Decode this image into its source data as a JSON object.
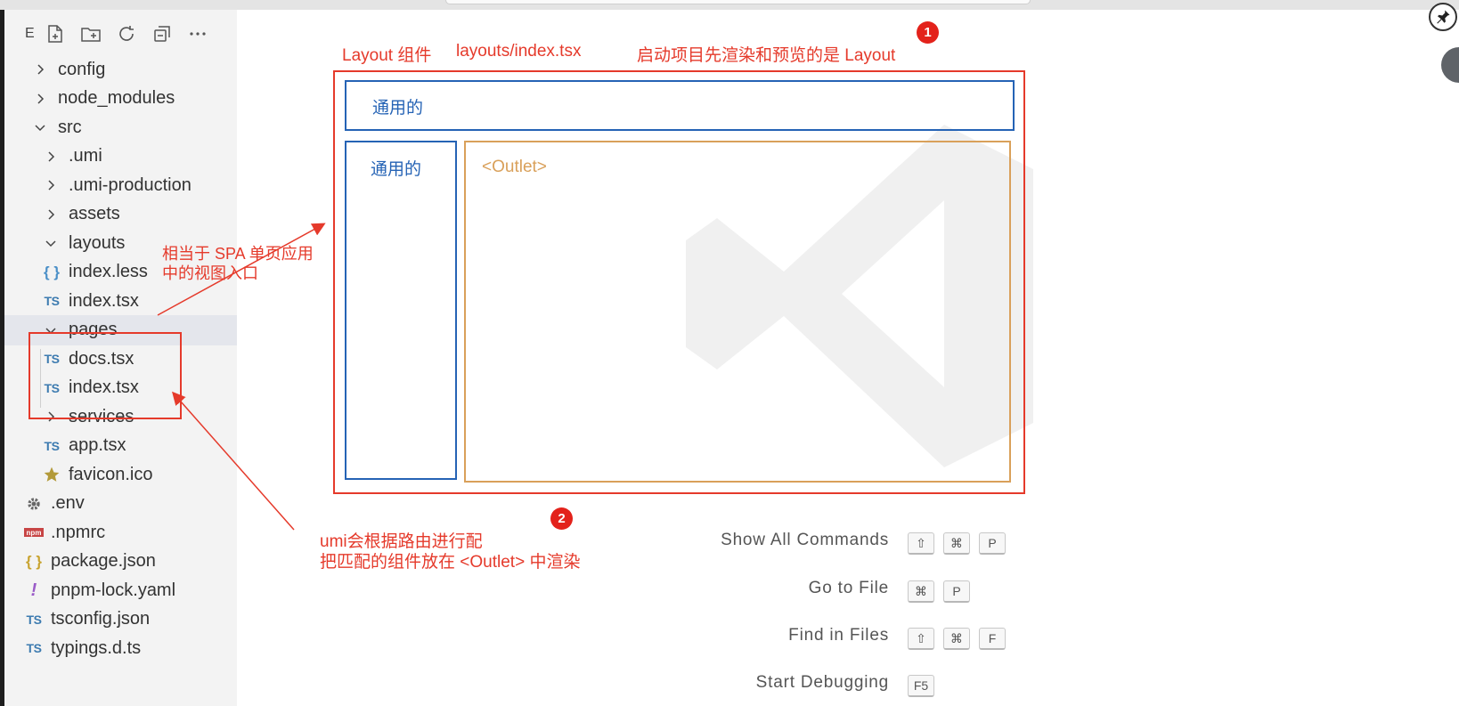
{
  "explorer": {
    "toolbar": {
      "label": "E",
      "icons": [
        "new-file-icon",
        "new-folder-icon",
        "refresh-icon",
        "collapse-all-icon",
        "more-icon"
      ]
    },
    "items": [
      {
        "label": "config",
        "type": "folder",
        "expanded": false
      },
      {
        "label": "node_modules",
        "type": "folder",
        "expanded": false
      },
      {
        "label": "src",
        "type": "folder",
        "expanded": true
      },
      {
        "label": ".umi",
        "type": "folder",
        "expanded": false
      },
      {
        "label": ".umi-production",
        "type": "folder",
        "expanded": false
      },
      {
        "label": "assets",
        "type": "folder",
        "expanded": false
      },
      {
        "label": "layouts",
        "type": "folder",
        "expanded": true
      },
      {
        "label": "index.less",
        "type": "file",
        "icon": "{ }"
      },
      {
        "label": "index.tsx",
        "type": "file",
        "icon": "TS"
      },
      {
        "label": "pages",
        "type": "folder",
        "expanded": true,
        "selected": true
      },
      {
        "label": "docs.tsx",
        "type": "file",
        "icon": "TS"
      },
      {
        "label": "index.tsx",
        "type": "file",
        "icon": "TS"
      },
      {
        "label": "services",
        "type": "folder",
        "expanded": false
      },
      {
        "label": "app.tsx",
        "type": "file",
        "icon": "TS"
      },
      {
        "label": "favicon.ico",
        "type": "file",
        "icon": "star"
      },
      {
        "label": ".env",
        "type": "file",
        "icon": "gear"
      },
      {
        "label": ".npmrc",
        "type": "file",
        "icon": "npm"
      },
      {
        "label": "package.json",
        "type": "file",
        "icon": "{ }"
      },
      {
        "label": "pnpm-lock.yaml",
        "type": "file",
        "icon": "!"
      },
      {
        "label": "tsconfig.json",
        "type": "file",
        "icon": "TS"
      },
      {
        "label": "typings.d.ts",
        "type": "file",
        "icon": "TS"
      }
    ]
  },
  "annotations": {
    "layout_label": "Layout 组件",
    "layout_path": "layouts/index.tsx",
    "layout_note": "启动项目先渲染和预览的是 Layout",
    "badge1": "1",
    "badge2": "2",
    "spa_line1": "相当于 SPA 单页应用",
    "spa_line2": "中的视图入口",
    "header_box": "通用的",
    "side_box": "通用的",
    "outlet": "<Outlet>",
    "umi_line1": "umi会根据路由进行配",
    "umi_line2": "把匹配的组件放在 <Outlet> 中渲染"
  },
  "shortcuts": [
    {
      "label": "Show All Commands",
      "keys": [
        "⇧",
        "⌘",
        "P"
      ]
    },
    {
      "label": "Go to File",
      "keys": [
        "⌘",
        "P"
      ]
    },
    {
      "label": "Find in Files",
      "keys": [
        "⇧",
        "⌘",
        "F"
      ]
    },
    {
      "label": "Start Debugging",
      "keys": [
        "F5"
      ]
    }
  ],
  "colors": {
    "annotation_red": "#e53a2b",
    "box_blue": "#2563b5",
    "outlet_orange": "#d9a05a"
  }
}
